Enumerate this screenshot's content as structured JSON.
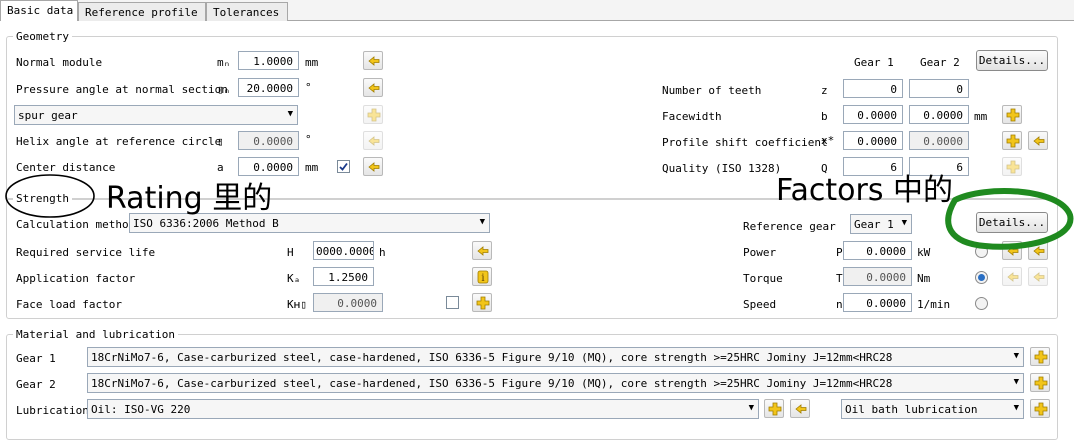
{
  "tabs": [
    "Basic data",
    "Reference profile",
    "Tolerances"
  ],
  "geometry": {
    "title": "Geometry",
    "normal_module": {
      "label": "Normal module",
      "symbol": "mₙ",
      "value": "1.0000",
      "unit": "mm"
    },
    "pressure_angle": {
      "label": "Pressure angle at normal section",
      "symbol": "▯ₙ",
      "value": "20.0000",
      "unit": "°"
    },
    "gear_type": "spur gear",
    "helix_angle": {
      "label": "Helix angle at reference circle",
      "symbol": "▯",
      "value": "0.0000",
      "unit": "°"
    },
    "center_distance": {
      "label": "Center distance",
      "symbol": "a",
      "value": "0.0000",
      "unit": "mm"
    },
    "gear1_header": "Gear 1",
    "gear2_header": "Gear 2",
    "details_label": "Details...",
    "number_of_teeth": {
      "label": "Number of teeth",
      "symbol": "z",
      "gear1": "0",
      "gear2": "0"
    },
    "facewidth": {
      "label": "Facewidth",
      "symbol": "b",
      "gear1": "0.0000",
      "gear2": "0.0000",
      "unit": "mm"
    },
    "profile_shift": {
      "label": "Profile shift coefficient",
      "symbol": "x*",
      "gear1": "0.0000",
      "gear2": "0.0000"
    },
    "quality": {
      "label": "Quality (ISO 1328)",
      "symbol": "Q",
      "gear1": "6",
      "gear2": "6"
    }
  },
  "strength": {
    "title": "Strength",
    "calc_method_label": "Calculation method",
    "calc_method_value": "ISO 6336:2006 Method B",
    "service_life": {
      "label": "Required service life",
      "symbol": "H",
      "value": "0000.0000",
      "unit": "h"
    },
    "application_factor": {
      "label": "Application factor",
      "symbol": "Kₐ",
      "value": "1.2500"
    },
    "face_load_factor": {
      "label": "Face load factor",
      "symbol": "Kʜ▯",
      "value": "0.0000"
    },
    "reference_gear": {
      "label": "Reference gear",
      "value": "Gear 1"
    },
    "details_label": "Details...",
    "power": {
      "label": "Power",
      "symbol": "P",
      "value": "0.0000",
      "unit": "kW"
    },
    "torque": {
      "label": "Torque",
      "symbol": "T",
      "value": "0.0000",
      "unit": "Nm"
    },
    "speed": {
      "label": "Speed",
      "symbol": "n",
      "value": "0.0000",
      "unit": "1/min"
    }
  },
  "material": {
    "title": "Material and lubrication",
    "gear1": {
      "label": "Gear 1",
      "value": "18CrNiMo7-6, Case-carburized steel, case-hardened, ISO 6336-5 Figure 9/10 (MQ), core strength >=25HRC Jominy J=12mm<HRC28"
    },
    "gear2": {
      "label": "Gear 2",
      "value": "18CrNiMo7-6, Case-carburized steel, case-hardened, ISO 6336-5 Figure 9/10 (MQ), core strength >=25HRC Jominy J=12mm<HRC28"
    },
    "lubrication": {
      "label": "Lubrication",
      "value": "Oil: ISO-VG 220",
      "type": "Oil bath lubrication"
    }
  },
  "annotations": {
    "left_text": "Rating 里的",
    "right_text": "Factors 中的",
    "circle_color": "#1f8a1f"
  },
  "colors": {
    "accent": "#f2c51a",
    "border": "#9aa8b8",
    "radio_selected": "#2a6fc4"
  }
}
